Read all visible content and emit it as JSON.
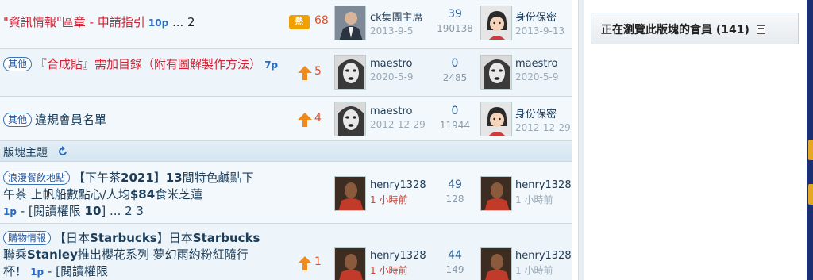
{
  "threads": [
    {
      "tag": "",
      "title_parts": [
        {
          "text": "\"資訊情報\"區章 - 申請指引",
          "style": "red"
        },
        {
          "text": " 10p",
          "style": "blue"
        },
        {
          "text": " ... 2",
          "style": "dark"
        }
      ],
      "icon": "hot-icon",
      "icon_label": "熱",
      "icon_count": "68",
      "author": "ck集團主席",
      "author_date": "2013-9-5",
      "author_avatar": "man-suit-avatar",
      "replies": "39",
      "views": "190138",
      "last_poster": "身份保密",
      "last_date": "2013-9-13",
      "last_avatar": "anonymous-girl-avatar"
    },
    {
      "tag": "其他",
      "title_parts": [
        {
          "text": "『合成貼』需加目錄（附有圖解製作方法）",
          "style": "red"
        },
        {
          "text": " 7p",
          "style": "blue"
        }
      ],
      "icon": "up-arrow-icon",
      "icon_count": "5",
      "author": "maestro",
      "author_date": "2020-5-9",
      "author_avatar": "woman-face-avatar",
      "replies": "0",
      "views": "2485",
      "last_poster": "maestro",
      "last_date": "2020-5-9",
      "last_avatar": "woman-face-avatar"
    },
    {
      "tag": "其他",
      "title_parts": [
        {
          "text": "違規會員名單",
          "style": "plain"
        }
      ],
      "icon": "up-arrow-icon",
      "icon_count": "4",
      "author": "maestro",
      "author_date": "2012-12-29",
      "author_avatar": "woman-face-avatar",
      "replies": "0",
      "views": "11944",
      "last_poster": "身份保密",
      "last_date": "2012-12-29",
      "last_avatar": "anonymous-girl-avatar"
    }
  ],
  "section_title": "版塊主題",
  "board_threads": [
    {
      "tag": "浪漫餐飲地點",
      "title_parts": [
        {
          "text": "【下午茶",
          "style": "plain"
        },
        {
          "text": "2021",
          "style": "bold"
        },
        {
          "text": "】",
          "style": "plain"
        },
        {
          "text": "13",
          "style": "bold"
        },
        {
          "text": "間特色鹹點下午茶 上帆船數點心/人均",
          "style": "plain"
        },
        {
          "text": "$84",
          "style": "bold"
        },
        {
          "text": "食米芝蓮",
          "style": "plain"
        }
      ],
      "meta_parts": [
        {
          "text": "1p",
          "style": "blue"
        },
        {
          "text": " - [閱讀權限 ",
          "style": "plain"
        },
        {
          "text": "10",
          "style": "bold"
        },
        {
          "text": "] ... 2  3",
          "style": "plain"
        }
      ],
      "icon": "",
      "icon_count": "",
      "author": "henry1328",
      "author_date": "1 小時前",
      "author_avatar": "man-photo-avatar",
      "replies": "49",
      "views": "128",
      "last_poster": "henry1328",
      "last_date": "1 小時前",
      "last_avatar": "man-photo-avatar"
    },
    {
      "tag": "購物情報",
      "title_parts": [
        {
          "text": "【日本",
          "style": "plain"
        },
        {
          "text": "Starbucks",
          "style": "bold"
        },
        {
          "text": "】日本",
          "style": "plain"
        },
        {
          "text": "Starbucks",
          "style": "bold"
        },
        {
          "text": "聯乘",
          "style": "plain"
        },
        {
          "text": "Stanley",
          "style": "bold"
        },
        {
          "text": "推出櫻花系列 夢幻雨約粉紅隨行杯！",
          "style": "plain"
        }
      ],
      "meta_parts": [
        {
          "text": " 1p",
          "style": "blue"
        },
        {
          "text": " - [閱讀權限",
          "style": "plain"
        }
      ],
      "icon": "up-arrow-icon",
      "icon_count": "1",
      "author": "henry1328",
      "author_date": "1 小時前",
      "author_avatar": "man-photo-avatar",
      "replies": "44",
      "views": "149",
      "last_poster": "henry1328",
      "last_date": "1 小時前",
      "last_avatar": "man-photo-avatar"
    }
  ],
  "sidebar": {
    "members_label": "正在瀏覽此版塊的會員",
    "members_count": "(141)"
  },
  "colors": {
    "red_title": "#cc2233",
    "link_blue": "#2a6cc0",
    "count_orange": "#e0502a",
    "recent_red": "#d04030"
  }
}
